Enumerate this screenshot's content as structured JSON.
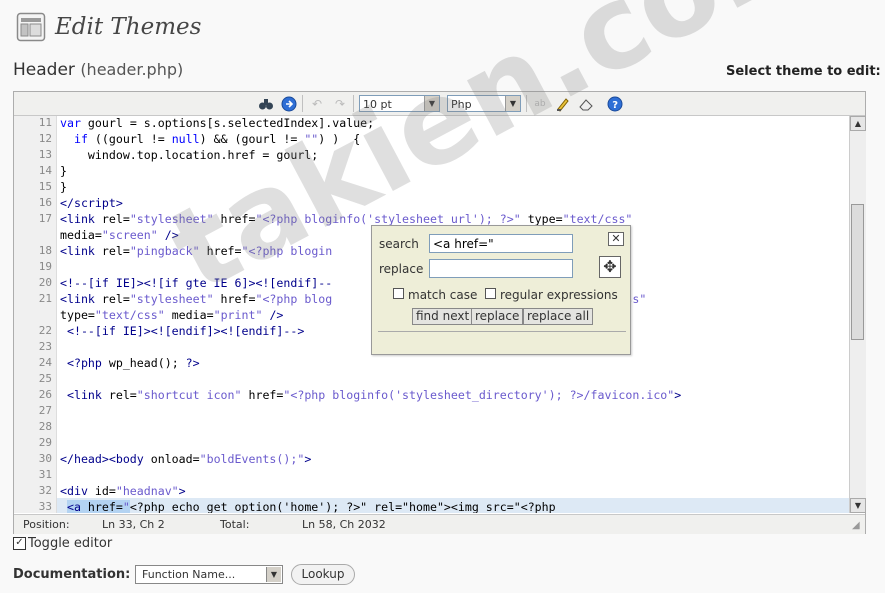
{
  "page": {
    "title": "Edit Themes",
    "file_heading": "Header",
    "file_name": "(header.php)",
    "select_theme_label": "Select theme to edit:"
  },
  "toolbar": {
    "font_size": "10 pt",
    "syntax": "Php",
    "icons": [
      "search-icon",
      "goto-line-icon",
      "undo-icon",
      "redo-icon",
      "spellcheck-icon",
      "highlight-icon",
      "reset-icon",
      "help-icon"
    ]
  },
  "code": {
    "lines": [
      {
        "n": "11",
        "html": "<span class='kw'>var</span> gourl = s.options[s.selectedIndex].value;"
      },
      {
        "n": "12",
        "html": "  <span class='kw'>if</span> ((gourl != <span class='kw'>null</span>) && (gourl != <span class='str'>\"\"</span>) )  {"
      },
      {
        "n": "13",
        "html": "    window.top.location.href = gourl;"
      },
      {
        "n": "14",
        "html": "}"
      },
      {
        "n": "15",
        "html": "}"
      },
      {
        "n": "16",
        "html": "<span class='tag'>&lt;/script&gt;</span>"
      },
      {
        "n": "17",
        "html": "<span class='tag'>&lt;link</span> rel=<span class='str'>\"stylesheet\"</span> href=<span class='str'>\"&lt;?php bloginfo('stylesheet_url'); ?&gt;\"</span> type=<span class='str'>\"text/css\"</span>"
      },
      {
        "n": "",
        "html": "media=<span class='str'>\"screen\"</span> <span class='tag'>/&gt;</span>"
      },
      {
        "n": "18",
        "html": "<span class='tag'>&lt;link</span> rel=<span class='str'>\"pingback\"</span> href=<span class='str'>\"&lt;?php blogin</span>"
      },
      {
        "n": "19",
        "html": ""
      },
      {
        "n": "20",
        "html": "<span class='tag'>&lt;!--[if IE]&gt;&lt;![if gte IE 6]&gt;&lt;![endif]--</span>"
      },
      {
        "n": "21",
        "html": "<span class='tag'>&lt;link</span> rel=<span class='str'>\"stylesheet\"</span> href=<span class='str'>\"&lt;?php blog                                  /print.css\"</span>"
      },
      {
        "n": "",
        "html": "type=<span class='str'>\"text/css\"</span> media=<span class='str'>\"print\"</span> <span class='tag'>/&gt;</span>"
      },
      {
        "n": "22",
        "html": " <span class='tag'>&lt;!--[if IE]&gt;&lt;![endif]&gt;&lt;![endif]--&gt;</span>"
      },
      {
        "n": "23",
        "html": ""
      },
      {
        "n": "24",
        "html": " <span class='tag'>&lt;?php</span> wp_head(); <span class='tag'>?&gt;</span>"
      },
      {
        "n": "25",
        "html": ""
      },
      {
        "n": "26",
        "html": " <span class='tag'>&lt;link</span> rel=<span class='str'>\"shortcut icon\"</span> href=<span class='str'>\"&lt;?php bloginfo('stylesheet_directory'); ?&gt;/favicon.ico\"</span><span class='tag'>&gt;</span>"
      },
      {
        "n": "27",
        "html": ""
      },
      {
        "n": "28",
        "html": ""
      },
      {
        "n": "29",
        "html": ""
      },
      {
        "n": "30",
        "html": "<span class='tag'>&lt;/head&gt;&lt;body</span> onload=<span class='str'>\"boldEvents();\"</span><span class='tag'>&gt;</span>"
      },
      {
        "n": "31",
        "html": ""
      },
      {
        "n": "32",
        "html": "<span class='tag'>&lt;div</span> id=<span class='str'>\"headnav\"</span><span class='tag'>&gt;</span>"
      },
      {
        "n": "33",
        "html": " <span class='sel'><span class='tag'>&lt;a</span> href=<span class='str'>\"</span></span>&lt;?php echo get_option('home'); ?&gt;\" rel=\"home\"&gt;&lt;img src=\"&lt;?php"
      }
    ]
  },
  "status": {
    "position_label": "Position:",
    "position_value": "Ln 33, Ch 2",
    "total_label": "Total:",
    "total_value": "Ln 58, Ch 2032"
  },
  "find_dialog": {
    "search_label": "search",
    "search_value": "<a href=\"",
    "replace_label": "replace",
    "replace_value": "",
    "match_case_label": "match case",
    "regex_label": "regular expressions",
    "find_next": "find next",
    "replace": "replace",
    "replace_all": "replace all",
    "close": "✕"
  },
  "watermark": "takien.com",
  "bottom": {
    "toggle_editor_label": "Toggle editor",
    "documentation_label": "Documentation:",
    "function_select": "Function Name...",
    "lookup_button": "Lookup"
  }
}
